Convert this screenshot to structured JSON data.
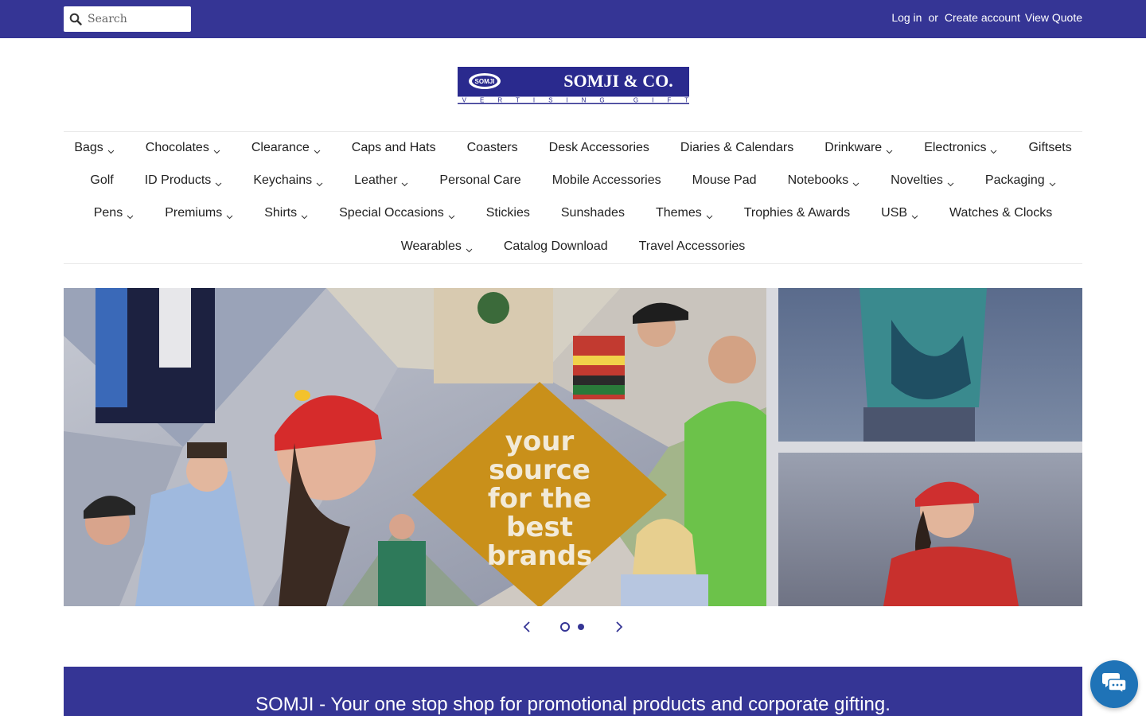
{
  "header": {
    "search_placeholder": "Search",
    "login_label": "Log in",
    "or_label": "or",
    "create_account_label": "Create account",
    "view_quote_label": "View Quote"
  },
  "logo": {
    "name": "SOMJI & CO.",
    "tagline": "ADVERTISING GIFTS",
    "badge": "SOMJI"
  },
  "nav": {
    "rows": [
      [
        {
          "label": "Bags",
          "dropdown": true
        },
        {
          "label": "Chocolates",
          "dropdown": true
        },
        {
          "label": "Clearance",
          "dropdown": true
        },
        {
          "label": "Caps and Hats",
          "dropdown": false
        },
        {
          "label": "Coasters",
          "dropdown": false
        },
        {
          "label": "Desk Accessories",
          "dropdown": false
        },
        {
          "label": "Diaries & Calendars",
          "dropdown": false
        },
        {
          "label": "Drinkware",
          "dropdown": true
        },
        {
          "label": "Electronics",
          "dropdown": true
        },
        {
          "label": "Giftsets",
          "dropdown": false
        }
      ],
      [
        {
          "label": "Golf",
          "dropdown": false
        },
        {
          "label": "ID Products",
          "dropdown": true
        },
        {
          "label": "Keychains",
          "dropdown": true
        },
        {
          "label": "Leather",
          "dropdown": true
        },
        {
          "label": "Personal Care",
          "dropdown": false
        },
        {
          "label": "Mobile Accessories",
          "dropdown": false
        },
        {
          "label": "Mouse Pad",
          "dropdown": false
        },
        {
          "label": "Notebooks",
          "dropdown": true
        },
        {
          "label": "Novelties",
          "dropdown": true
        },
        {
          "label": "Packaging",
          "dropdown": true
        }
      ],
      [
        {
          "label": "Pens",
          "dropdown": true
        },
        {
          "label": "Premiums",
          "dropdown": true
        },
        {
          "label": "Shirts",
          "dropdown": true
        },
        {
          "label": "Special Occasions",
          "dropdown": true
        },
        {
          "label": "Stickies",
          "dropdown": false
        },
        {
          "label": "Sunshades",
          "dropdown": false
        },
        {
          "label": "Themes",
          "dropdown": true
        },
        {
          "label": "Trophies & Awards",
          "dropdown": false
        },
        {
          "label": "USB",
          "dropdown": true
        },
        {
          "label": "Watches & Clocks",
          "dropdown": false
        }
      ],
      [
        {
          "label": "Wearables",
          "dropdown": true
        },
        {
          "label": "Catalog Download",
          "dropdown": false
        },
        {
          "label": "Travel Accessories",
          "dropdown": false
        }
      ]
    ]
  },
  "hero": {
    "slogan_lines": [
      "your",
      "source",
      "for the",
      "best",
      "brands"
    ],
    "slide_count": 2,
    "active_slide": 1
  },
  "banner": {
    "text": "SOMJI - Your one stop shop for promotional products and corporate gifting."
  },
  "colors": {
    "brand": "#353595",
    "accent_gold": "#c9901a",
    "chat": "#1f73b7"
  },
  "icons": {
    "search": "search-icon",
    "chevron": "chevron-down-icon",
    "prev": "chevron-left-icon",
    "next": "chevron-right-icon",
    "chat": "chat-icon"
  }
}
